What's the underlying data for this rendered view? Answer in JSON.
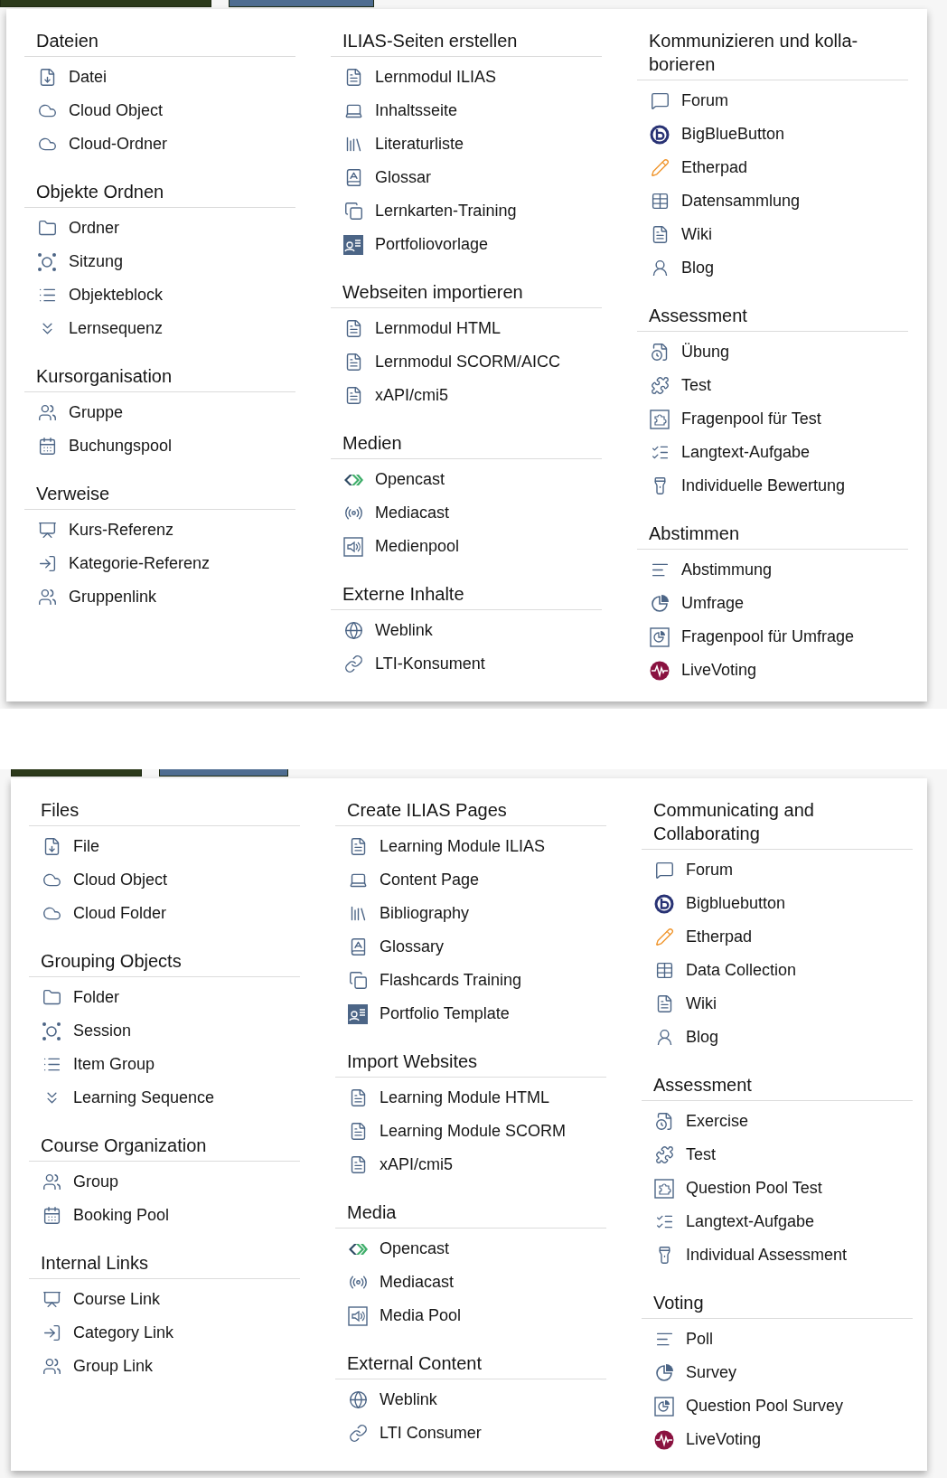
{
  "panels": [
    {
      "columns": [
        {
          "sections": [
            {
              "title": "Dateien",
              "items": [
                {
                  "label": "Datei"
                },
                {
                  "label": "Cloud Object"
                },
                {
                  "label": "Cloud-Ordner"
                }
              ]
            },
            {
              "title": "Objekte Ordnen",
              "items": [
                {
                  "label": "Ordner"
                },
                {
                  "label": "Sitzung"
                },
                {
                  "label": "Objekteblock"
                },
                {
                  "label": "Lernsequenz"
                }
              ]
            },
            {
              "title": "Kursorganisation",
              "items": [
                {
                  "label": "Gruppe"
                },
                {
                  "label": "Buchungspool"
                }
              ]
            },
            {
              "title": "Verweise",
              "items": [
                {
                  "label": "Kurs-Referenz"
                },
                {
                  "label": "Kategorie-Referenz"
                },
                {
                  "label": "Gruppenlink"
                }
              ]
            }
          ]
        },
        {
          "sections": [
            {
              "title": "ILIAS-Seiten erstellen",
              "items": [
                {
                  "label": "Lernmodul ILIAS"
                },
                {
                  "label": "Inhaltsseite"
                },
                {
                  "label": "Literaturliste"
                },
                {
                  "label": "Glossar"
                },
                {
                  "label": "Lernkarten-Training"
                },
                {
                  "label": "Portfoliovorlage"
                }
              ]
            },
            {
              "title": "Webseiten importieren",
              "items": [
                {
                  "label": "Lernmodul HTML"
                },
                {
                  "label": "Lernmodul SCORM/AICC"
                },
                {
                  "label": "xAPI/cmi5"
                }
              ]
            },
            {
              "title": "Medien",
              "items": [
                {
                  "label": "Opencast"
                },
                {
                  "label": "Mediacast"
                },
                {
                  "label": "Medienpool"
                }
              ]
            },
            {
              "title": "Externe Inhalte",
              "items": [
                {
                  "label": "Weblink"
                },
                {
                  "label": "LTI-Konsument"
                }
              ]
            }
          ]
        },
        {
          "sections": [
            {
              "title": "Kommunizieren und kolla-\nborieren",
              "items": [
                {
                  "label": "Forum"
                },
                {
                  "label": "BigBlueButton"
                },
                {
                  "label": "Etherpad"
                },
                {
                  "label": "Datensammlung"
                },
                {
                  "label": "Wiki"
                },
                {
                  "label": "Blog"
                }
              ]
            },
            {
              "title": "Assessment",
              "items": [
                {
                  "label": "Übung"
                },
                {
                  "label": "Test"
                },
                {
                  "label": "Fragenpool für Test"
                },
                {
                  "label": "Langtext-Aufgabe"
                },
                {
                  "label": "Individuelle Bewertung"
                }
              ]
            },
            {
              "title": "Abstimmen",
              "items": [
                {
                  "label": "Abstimmung"
                },
                {
                  "label": "Umfrage"
                },
                {
                  "label": "Fragenpool für Umfrage"
                },
                {
                  "label": "LiveVoting"
                }
              ]
            }
          ]
        }
      ]
    },
    {
      "columns": [
        {
          "sections": [
            {
              "title": "Files",
              "items": [
                {
                  "label": "File"
                },
                {
                  "label": "Cloud Object"
                },
                {
                  "label": "Cloud Folder"
                }
              ]
            },
            {
              "title": "Grouping Objects",
              "items": [
                {
                  "label": "Folder"
                },
                {
                  "label": "Session"
                },
                {
                  "label": "Item Group"
                },
                {
                  "label": "Learning Sequence"
                }
              ]
            },
            {
              "title": "Course Organization",
              "items": [
                {
                  "label": "Group"
                },
                {
                  "label": "Booking Pool"
                }
              ]
            },
            {
              "title": "Internal Links",
              "items": [
                {
                  "label": "Course Link"
                },
                {
                  "label": "Category Link"
                },
                {
                  "label": "Group Link"
                }
              ]
            }
          ]
        },
        {
          "sections": [
            {
              "title": "Create ILIAS Pages",
              "items": [
                {
                  "label": "Learning Module ILIAS"
                },
                {
                  "label": "Content Page"
                },
                {
                  "label": "Bibliography"
                },
                {
                  "label": "Glossary"
                },
                {
                  "label": "Flashcards Training"
                },
                {
                  "label": "Portfolio Template"
                }
              ]
            },
            {
              "title": "Import Websites",
              "items": [
                {
                  "label": "Learning Module HTML"
                },
                {
                  "label": "Learning Module SCORM"
                },
                {
                  "label": "xAPI/cmi5"
                }
              ]
            },
            {
              "title": "Media",
              "items": [
                {
                  "label": "Opencast"
                },
                {
                  "label": "Mediacast"
                },
                {
                  "label": "Media Pool"
                }
              ]
            },
            {
              "title": "External Content",
              "items": [
                {
                  "label": "Weblink"
                },
                {
                  "label": "LTI Consumer"
                }
              ]
            }
          ]
        },
        {
          "sections": [
            {
              "title": "Communicating and\nCollaborating",
              "items": [
                {
                  "label": "Forum"
                },
                {
                  "label": "Bigbluebutton"
                },
                {
                  "label": "Etherpad"
                },
                {
                  "label": "Data Collection"
                },
                {
                  "label": "Wiki"
                },
                {
                  "label": "Blog"
                }
              ]
            },
            {
              "title": "Assessment",
              "items": [
                {
                  "label": "Exercise"
                },
                {
                  "label": "Test"
                },
                {
                  "label": "Question Pool Test"
                },
                {
                  "label": "Langtext-Aufgabe"
                },
                {
                  "label": "Individual Assessment"
                }
              ]
            },
            {
              "title": "Voting",
              "items": [
                {
                  "label": "Poll"
                },
                {
                  "label": "Survey"
                },
                {
                  "label": "Question Pool Survey"
                },
                {
                  "label": "LiveVoting"
                }
              ]
            }
          ]
        }
      ]
    }
  ]
}
